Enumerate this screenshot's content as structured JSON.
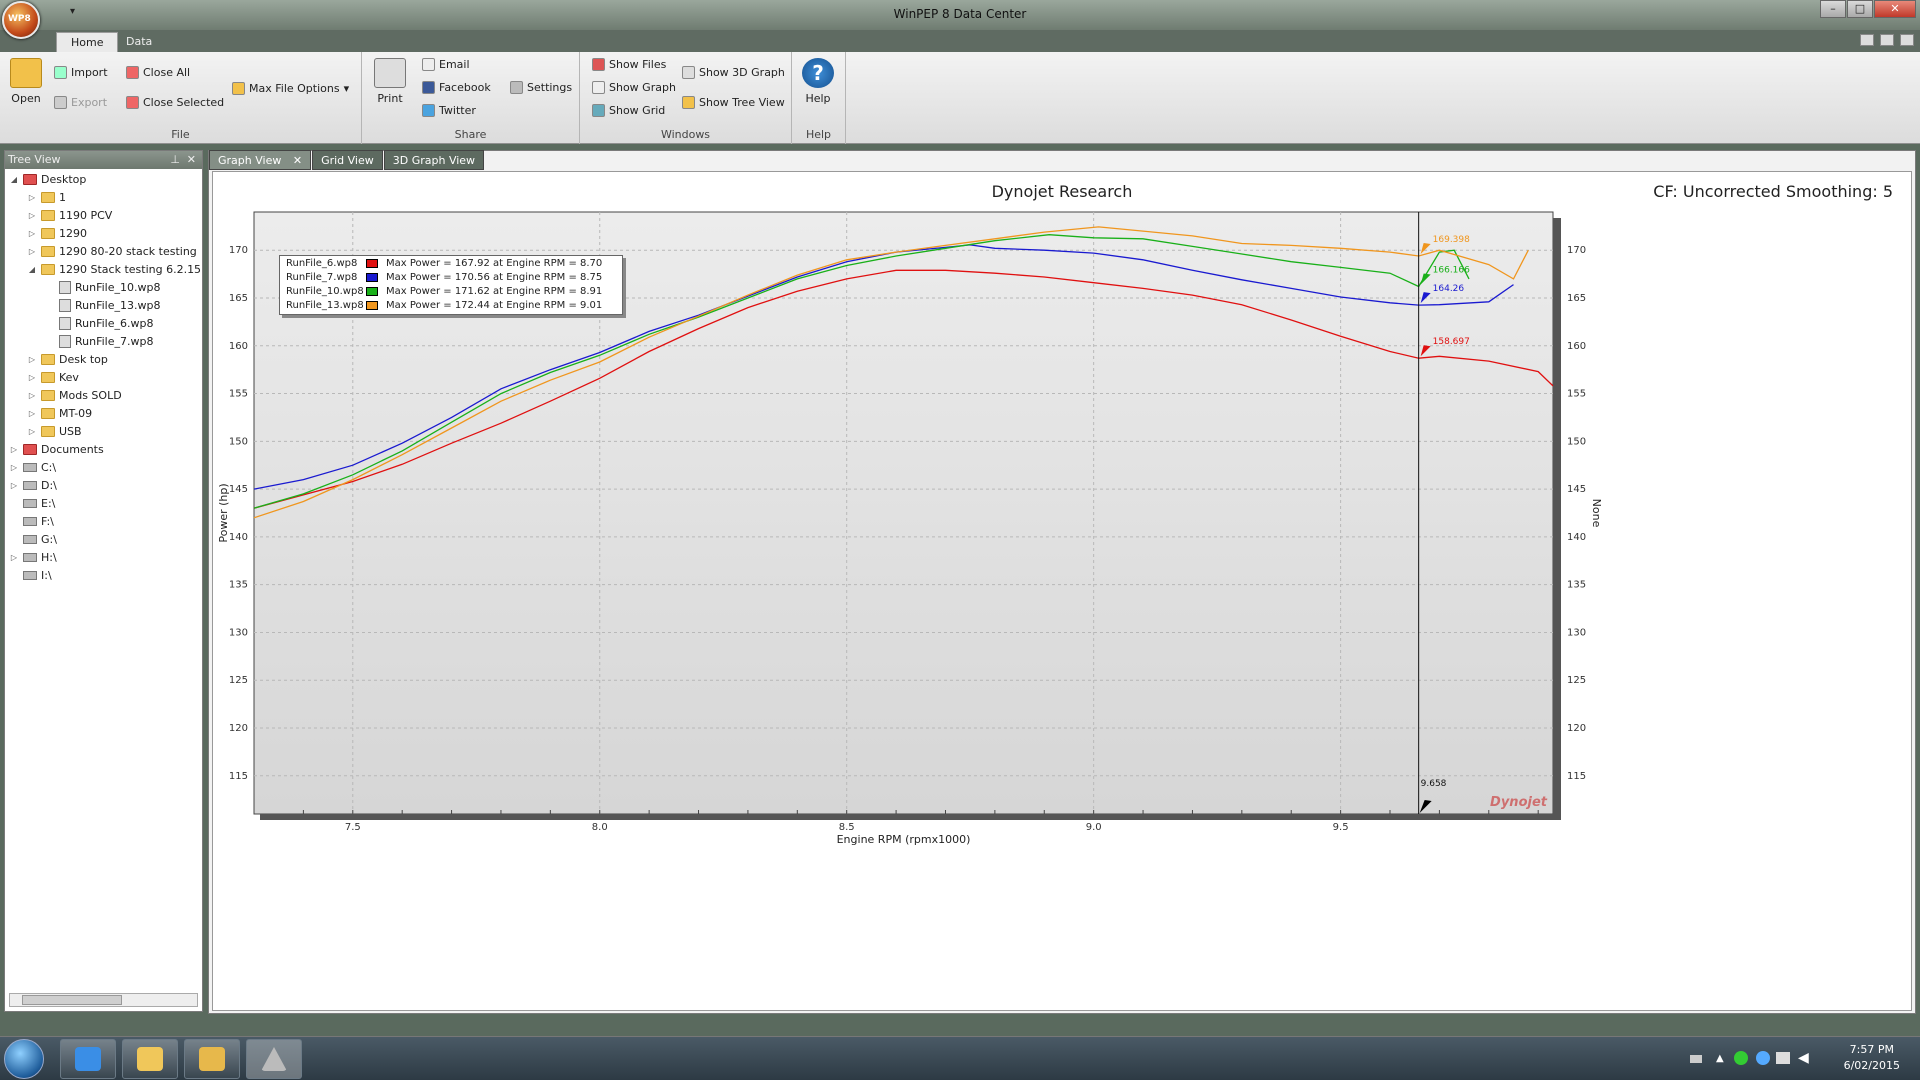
{
  "window": {
    "title": "WinPEP 8 Data Center",
    "logo_text": "WP8"
  },
  "ribbon_tabs": [
    "Home",
    "Data"
  ],
  "ribbon": {
    "open": "Open",
    "import": "Import",
    "export": "Export",
    "close_all": "Close All",
    "close_selected": "Close Selected",
    "max_file_options": "Max File Options",
    "file_label": "File",
    "print": "Print",
    "email": "Email",
    "facebook": "Facebook",
    "twitter": "Twitter",
    "settings": "Settings",
    "share_label": "Share",
    "show_files": "Show Files",
    "show_graph": "Show Graph",
    "show_grid": "Show Grid",
    "show_3d_graph": "Show 3D Graph",
    "show_tree_view": "Show Tree View",
    "windows_label": "Windows",
    "help": "Help",
    "help_label": "Help"
  },
  "tree": {
    "title": "Tree View",
    "items": [
      {
        "label": "Desktop",
        "level": 0,
        "kind": "red",
        "expanded": true
      },
      {
        "label": "1",
        "level": 1,
        "kind": "folder"
      },
      {
        "label": "1190 PCV",
        "level": 1,
        "kind": "folder"
      },
      {
        "label": "1290",
        "level": 1,
        "kind": "folder"
      },
      {
        "label": "1290 80-20 stack testing",
        "level": 1,
        "kind": "folder"
      },
      {
        "label": "1290 Stack testing 6.2.15",
        "level": 1,
        "kind": "folder",
        "expanded": true
      },
      {
        "label": "RunFile_10.wp8",
        "level": 2,
        "kind": "file"
      },
      {
        "label": "RunFile_13.wp8",
        "level": 2,
        "kind": "file"
      },
      {
        "label": "RunFile_6.wp8",
        "level": 2,
        "kind": "file"
      },
      {
        "label": "RunFile_7.wp8",
        "level": 2,
        "kind": "file"
      },
      {
        "label": "Desk top",
        "level": 1,
        "kind": "folder"
      },
      {
        "label": "Kev",
        "level": 1,
        "kind": "folder"
      },
      {
        "label": "Mods SOLD",
        "level": 1,
        "kind": "folder"
      },
      {
        "label": "MT-09",
        "level": 1,
        "kind": "folder"
      },
      {
        "label": "USB",
        "level": 1,
        "kind": "folder"
      },
      {
        "label": "Documents",
        "level": 0,
        "kind": "red"
      },
      {
        "label": "C:\\",
        "level": 0,
        "kind": "drive"
      },
      {
        "label": "D:\\",
        "level": 0,
        "kind": "drive"
      },
      {
        "label": "E:\\",
        "level": 0,
        "kind": "drive",
        "noarrow": true
      },
      {
        "label": "F:\\",
        "level": 0,
        "kind": "drive",
        "noarrow": true
      },
      {
        "label": "G:\\",
        "level": 0,
        "kind": "drive",
        "noarrow": true
      },
      {
        "label": "H:\\",
        "level": 0,
        "kind": "drive"
      },
      {
        "label": "I:\\",
        "level": 0,
        "kind": "drive",
        "noarrow": true
      }
    ]
  },
  "doc_tabs": [
    "Graph View",
    "Grid View",
    "3D Graph View"
  ],
  "graph": {
    "title": "Dynojet Research",
    "header_right": "CF: Uncorrected Smoothing: 5",
    "cursor_label": "9.658",
    "watermark": "Dynojet"
  },
  "legend": [
    {
      "file": "RunFile_6.wp8",
      "text": "Max Power = 167.92 at Engine RPM = 8.70",
      "color": "#e01010"
    },
    {
      "file": "RunFile_7.wp8",
      "text": "Max Power = 170.56 at Engine RPM = 8.75",
      "color": "#1a1ad0"
    },
    {
      "file": "RunFile_10.wp8",
      "text": "Max Power = 171.62 at Engine RPM = 8.91",
      "color": "#19b019"
    },
    {
      "file": "RunFile_13.wp8",
      "text": "Max Power = 172.44 at Engine RPM = 9.01",
      "color": "#f0961e"
    }
  ],
  "chart_data": {
    "type": "line",
    "title": "Dynojet Research",
    "xlabel": "Engine RPM (rpmx1000)",
    "ylabel": "Power (hp)",
    "y2label": "None",
    "xlim": [
      7.3,
      9.93
    ],
    "ylim": [
      111,
      174
    ],
    "xticks": [
      7.5,
      8.0,
      8.5,
      9.0,
      9.5
    ],
    "yticks": [
      115,
      120,
      125,
      130,
      135,
      140,
      145,
      150,
      155,
      160,
      165,
      170
    ],
    "grid": true,
    "cursor_x": 9.658,
    "series": [
      {
        "name": "RunFile_6.wp8",
        "color": "#e01010",
        "x": [
          7.3,
          7.5,
          7.6,
          7.7,
          7.8,
          7.9,
          8.0,
          8.1,
          8.2,
          8.3,
          8.4,
          8.5,
          8.6,
          8.7,
          8.8,
          8.9,
          9.0,
          9.1,
          9.2,
          9.3,
          9.4,
          9.5,
          9.6,
          9.658,
          9.7,
          9.8,
          9.9,
          9.93
        ],
        "y": [
          143,
          145.8,
          147.6,
          149.8,
          151.9,
          154.2,
          156.6,
          159.4,
          161.8,
          164.0,
          165.7,
          167.0,
          167.9,
          167.9,
          167.6,
          167.2,
          166.6,
          166.0,
          165.3,
          164.3,
          162.7,
          161.0,
          159.4,
          158.7,
          158.9,
          158.4,
          157.3,
          155.8
        ],
        "label": "158.697"
      },
      {
        "name": "RunFile_7.wp8",
        "color": "#1a1ad0",
        "x": [
          7.3,
          7.4,
          7.5,
          7.6,
          7.7,
          7.8,
          7.9,
          8.0,
          8.1,
          8.2,
          8.3,
          8.4,
          8.5,
          8.6,
          8.7,
          8.75,
          8.8,
          8.9,
          9.0,
          9.1,
          9.2,
          9.3,
          9.4,
          9.5,
          9.6,
          9.658,
          9.7,
          9.8,
          9.85
        ],
        "y": [
          145.0,
          146.0,
          147.5,
          149.8,
          152.5,
          155.5,
          157.5,
          159.3,
          161.5,
          163.2,
          165.2,
          167.2,
          168.8,
          169.8,
          170.3,
          170.56,
          170.2,
          170.0,
          169.7,
          169.0,
          167.9,
          166.9,
          166.0,
          165.1,
          164.5,
          164.26,
          164.3,
          164.6,
          166.4
        ],
        "label": "164.26"
      },
      {
        "name": "RunFile_10.wp8",
        "color": "#19b019",
        "x": [
          7.3,
          7.4,
          7.5,
          7.6,
          7.7,
          7.8,
          7.9,
          8.0,
          8.1,
          8.2,
          8.3,
          8.4,
          8.5,
          8.6,
          8.7,
          8.8,
          8.91,
          9.0,
          9.1,
          9.2,
          9.3,
          9.4,
          9.5,
          9.6,
          9.658,
          9.7,
          9.73,
          9.76
        ],
        "y": [
          143.0,
          144.5,
          146.5,
          149.0,
          152.0,
          155.0,
          157.2,
          159.0,
          161.2,
          163.0,
          165.0,
          167.0,
          168.4,
          169.4,
          170.2,
          171.0,
          171.62,
          171.3,
          171.2,
          170.4,
          169.6,
          168.8,
          168.2,
          167.6,
          166.2,
          169.8,
          170.0,
          167.0
        ],
        "label": "166.166"
      },
      {
        "name": "RunFile_13.wp8",
        "color": "#f0961e",
        "x": [
          7.3,
          7.4,
          7.5,
          7.6,
          7.7,
          7.8,
          7.9,
          8.0,
          8.1,
          8.2,
          8.3,
          8.4,
          8.5,
          8.6,
          8.7,
          8.8,
          8.9,
          9.01,
          9.1,
          9.2,
          9.3,
          9.4,
          9.5,
          9.6,
          9.658,
          9.7,
          9.8,
          9.85,
          9.88
        ],
        "y": [
          142.0,
          143.7,
          146.0,
          148.6,
          151.4,
          154.2,
          156.4,
          158.3,
          160.9,
          163.1,
          165.3,
          167.4,
          169.0,
          169.8,
          170.5,
          171.2,
          171.9,
          172.44,
          172.0,
          171.5,
          170.7,
          170.5,
          170.2,
          169.8,
          169.4,
          170.0,
          168.5,
          167.0,
          170.0
        ],
        "label": "169.398"
      }
    ]
  },
  "taskbar": {
    "time": "7:57 PM",
    "date": "6/02/2015"
  }
}
